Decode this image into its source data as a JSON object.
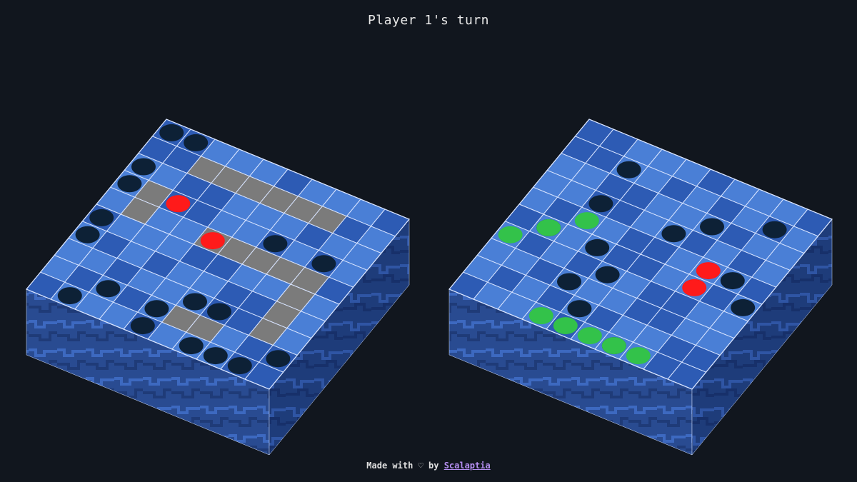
{
  "status": {
    "turn_text": "Player 1's turn"
  },
  "footer": {
    "made_with": "Made with",
    "heart": "♡",
    "by": "by",
    "author_link": "Scalaptia"
  },
  "colors": {
    "background": "#11161e",
    "tile_light": "#4a7fd6",
    "tile_dark": "#2d5bb4",
    "grid_line": "#d8e4ff",
    "side_left": "#2a4d95",
    "side_right": "#1f3d7a",
    "ship_cell": "#7b7b7b",
    "empty_hole": "#0d2136",
    "hit_peg": "#ff1a1a",
    "guess_peg": "#33c24a",
    "link": "#b48ef0"
  },
  "boards": [
    {
      "name": "own-fleet-board",
      "size": 10,
      "ship_cells": [
        [
          1,
          2
        ],
        [
          1,
          3
        ],
        [
          1,
          4
        ],
        [
          1,
          5
        ],
        [
          1,
          6
        ],
        [
          1,
          7
        ],
        [
          3,
          1
        ],
        [
          4,
          1
        ],
        [
          4,
          4
        ],
        [
          4,
          5
        ],
        [
          4,
          6
        ],
        [
          4,
          7
        ],
        [
          4,
          8
        ],
        [
          5,
          8
        ],
        [
          6,
          8
        ],
        [
          7,
          8
        ],
        [
          8,
          5
        ],
        [
          8,
          6
        ]
      ],
      "holes": [
        [
          0,
          0
        ],
        [
          0,
          1
        ],
        [
          2,
          0
        ],
        [
          3,
          0
        ],
        [
          5,
          0
        ],
        [
          6,
          0
        ],
        [
          9,
          1
        ],
        [
          8,
          2
        ],
        [
          3,
          6
        ],
        [
          3,
          8
        ],
        [
          7,
          5
        ],
        [
          8,
          4
        ],
        [
          9,
          4
        ],
        [
          7,
          6
        ],
        [
          9,
          6
        ],
        [
          9,
          7
        ],
        [
          9,
          8
        ],
        [
          8,
          9
        ]
      ],
      "red_pegs": [
        [
          3,
          2
        ],
        [
          4,
          4
        ]
      ]
    },
    {
      "name": "opponent-target-board",
      "size": 10,
      "ship_cells": [],
      "holes": [
        [
          1,
          2
        ],
        [
          3,
          2
        ],
        [
          3,
          5
        ],
        [
          2,
          6
        ],
        [
          5,
          1
        ],
        [
          6,
          4
        ],
        [
          8,
          4
        ],
        [
          9,
          6
        ],
        [
          5,
          3
        ],
        [
          7,
          3
        ],
        [
          4,
          8
        ],
        [
          5,
          9
        ],
        [
          1,
          8
        ]
      ],
      "red_pegs": [
        [
          4,
          7
        ],
        [
          5,
          7
        ]
      ],
      "green_pegs": [
        [
          6,
          0
        ],
        [
          5,
          1
        ],
        [
          4,
          2
        ],
        [
          9,
          3
        ],
        [
          9,
          4
        ],
        [
          9,
          5
        ],
        [
          9,
          6
        ],
        [
          9,
          7
        ]
      ]
    }
  ]
}
